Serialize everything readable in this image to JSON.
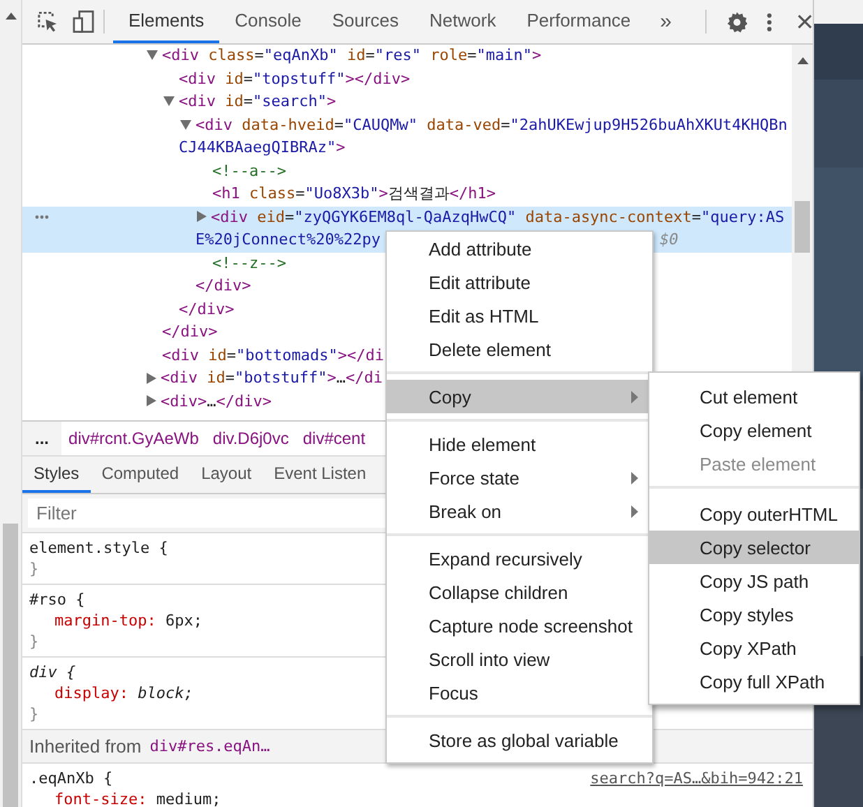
{
  "toolbar": {
    "tabs": [
      {
        "label": "Elements",
        "selected": true
      },
      {
        "label": "Console",
        "selected": false
      },
      {
        "label": "Sources",
        "selected": false
      },
      {
        "label": "Network",
        "selected": false
      },
      {
        "label": "Performance",
        "selected": false
      }
    ],
    "overflow": "»"
  },
  "dom_tree": {
    "nodes": [
      {
        "kind": "expanded",
        "selected": false,
        "lines": [
          "<div class=\"eqAnXb\" id=\"res\" role=\"main\">"
        ],
        "close": "</div>",
        "children": [
          {
            "kind": "leaf",
            "selected": false,
            "lines": [
              "<div id=\"topstuff\"></div>"
            ]
          },
          {
            "kind": "expanded",
            "selected": false,
            "lines": [
              "<div id=\"search\">"
            ],
            "close": "</div>",
            "children": [
              {
                "kind": "expanded",
                "selected": false,
                "lines": [
                  "<div data-hveid=\"CAUQMw\" data-ved=\"2ahUKEwjup9H526buAhXKUt4KHQBn",
                  "CJ44KBAaegQIBRAz\">"
                ],
                "close": "</div>",
                "children": [
                  {
                    "kind": "leaf",
                    "selected": false,
                    "lines": [
                      "<!--a-->"
                    ]
                  },
                  {
                    "kind": "leaf",
                    "selected": false,
                    "lines": [
                      "<h1 class=\"Uo8X3b\">검색결과</h1>"
                    ]
                  },
                  {
                    "kind": "collapsed",
                    "selected": true,
                    "lines": [
                      "<div eid=\"zyQGYK6EM8ql-QaAzqHwCQ\" data-async-context=\"query:AS",
                      "E%20jConnect%20%22py"
                    ],
                    "badge": "$0"
                  },
                  {
                    "kind": "leaf",
                    "selected": false,
                    "lines": [
                      "<!--z-->"
                    ]
                  }
                ]
              }
            ]
          }
        ]
      },
      {
        "kind": "leaf",
        "selected": false,
        "lines": [
          "<div id=\"bottomads\"></di"
        ]
      },
      {
        "kind": "collapsed",
        "selected": false,
        "lines": [
          "<div id=\"botstuff\">…</di"
        ]
      },
      {
        "kind": "collapsed",
        "selected": false,
        "lines": [
          "<div>…</div>"
        ]
      }
    ]
  },
  "breadcrumbs": {
    "more": "...",
    "crumbs": [
      "div#rcnt.GyAeWb",
      "div.D6j0vc",
      "div#cent"
    ]
  },
  "styles_pane": {
    "tabs": [
      {
        "label": "Styles",
        "selected": true
      },
      {
        "label": "Computed",
        "selected": false
      },
      {
        "label": "Layout",
        "selected": false
      },
      {
        "label": "Event Listen",
        "selected": false
      }
    ],
    "filter": {
      "placeholder": "Filter"
    },
    "rules": [
      {
        "kind": "rule",
        "selector": "element.style {",
        "close": "}"
      },
      {
        "kind": "rule",
        "selector": "#rso {",
        "properties": [
          {
            "name": "margin-top:",
            "value": "6px;"
          }
        ],
        "close": "}"
      },
      {
        "kind": "user-agent",
        "selector": "div {",
        "properties": [
          {
            "name": "display:",
            "value": "block;"
          }
        ],
        "close": "}"
      },
      {
        "kind": "inherited",
        "label": "Inherited from",
        "link": "div#res.eqAn…"
      },
      {
        "kind": "rule",
        "selector": ".eqAnXb {",
        "source": "search?q=AS…&bih=942:21",
        "properties": [
          {
            "name": "font-size:",
            "value": "medium;"
          }
        ]
      }
    ]
  },
  "context_menu": {
    "groups": [
      {
        "items": [
          {
            "label": "Add attribute",
            "selected": false,
            "arrow": false
          },
          {
            "label": "Edit attribute",
            "selected": false,
            "arrow": false
          },
          {
            "label": "Edit as HTML",
            "selected": false,
            "arrow": false
          },
          {
            "label": "Delete element",
            "selected": false,
            "arrow": false
          }
        ]
      },
      {
        "items": [
          {
            "label": "Copy",
            "selected": true,
            "arrow": true,
            "submenu": {
              "groups": [
                {
                  "items": [
                    {
                      "label": "Cut element",
                      "selected": false,
                      "disabled": false
                    },
                    {
                      "label": "Copy element",
                      "selected": false,
                      "disabled": false
                    },
                    {
                      "label": "Paste element",
                      "selected": false,
                      "disabled": true
                    }
                  ]
                },
                {
                  "items": [
                    {
                      "label": "Copy outerHTML",
                      "selected": false,
                      "disabled": false
                    },
                    {
                      "label": "Copy selector",
                      "selected": true,
                      "disabled": false
                    },
                    {
                      "label": "Copy JS path",
                      "selected": false,
                      "disabled": false
                    },
                    {
                      "label": "Copy styles",
                      "selected": false,
                      "disabled": false
                    },
                    {
                      "label": "Copy XPath",
                      "selected": false,
                      "disabled": false
                    },
                    {
                      "label": "Copy full XPath",
                      "selected": false,
                      "disabled": false
                    }
                  ]
                }
              ]
            }
          }
        ]
      },
      {
        "items": [
          {
            "label": "Hide element",
            "selected": false,
            "arrow": false
          },
          {
            "label": "Force state",
            "selected": false,
            "arrow": true
          },
          {
            "label": "Break on",
            "selected": false,
            "arrow": true
          }
        ]
      },
      {
        "items": [
          {
            "label": "Expand recursively",
            "selected": false,
            "arrow": false
          },
          {
            "label": "Collapse children",
            "selected": false,
            "arrow": false
          },
          {
            "label": "Capture node screenshot",
            "selected": false,
            "arrow": false
          },
          {
            "label": "Scroll into view",
            "selected": false,
            "arrow": false
          },
          {
            "label": "Focus",
            "selected": false,
            "arrow": false
          }
        ]
      },
      {
        "items": [
          {
            "label": "Store as global variable",
            "selected": false,
            "arrow": false
          }
        ]
      }
    ]
  }
}
